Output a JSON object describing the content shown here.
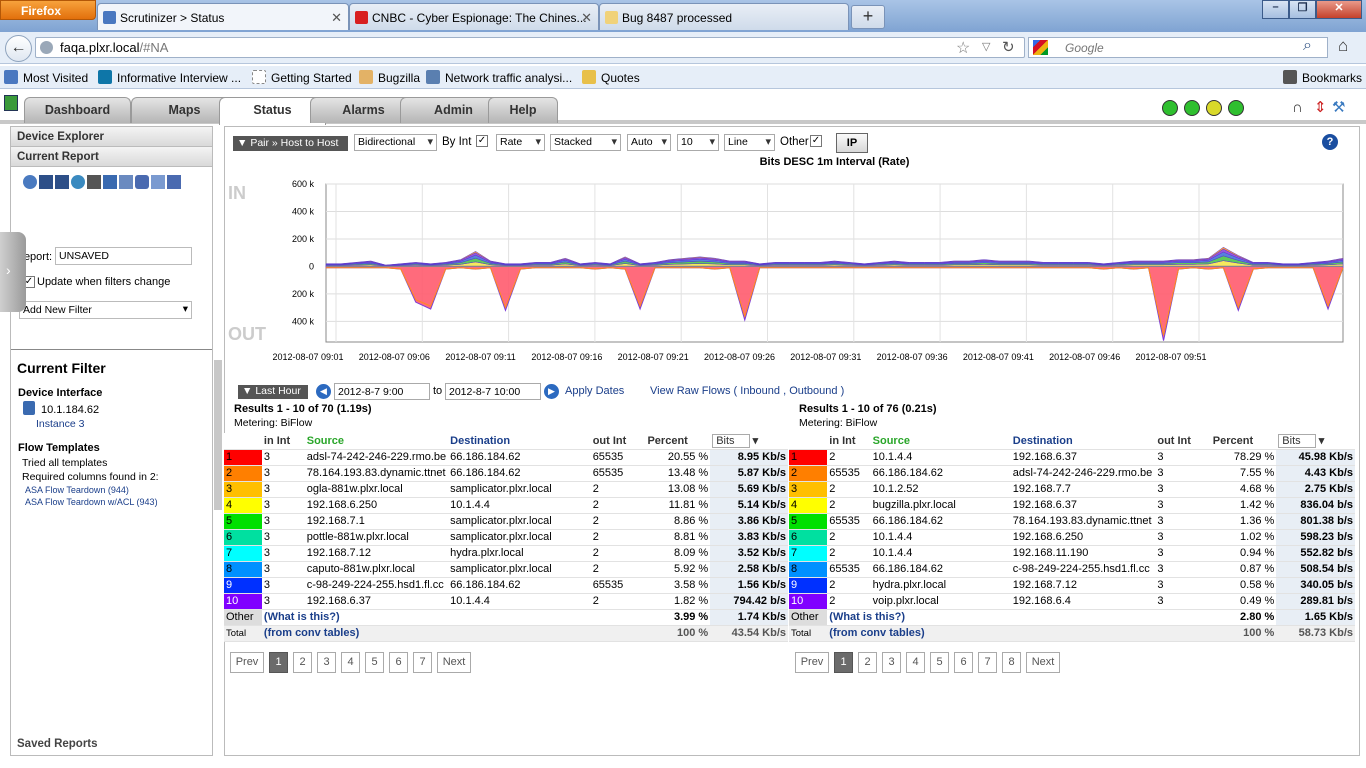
{
  "browser": {
    "menu_label": "Firefox",
    "tabs": [
      {
        "title": "Scrutinizer > Status",
        "active": true,
        "icon_color": "#4a78c0"
      },
      {
        "title": "CNBC - Cyber Espionage: The Chines...",
        "active": false,
        "icon_color": "#d81f1f"
      },
      {
        "title": "Bug 8487 processed",
        "active": false,
        "icon_color": "#f0d27a"
      }
    ],
    "new_tab": "+",
    "url_host": "faqa.plxr.local",
    "url_path": "/#NA",
    "search_placeholder": "Google",
    "bookmarks": [
      {
        "label": "Most Visited",
        "color": "#4a78c0"
      },
      {
        "label": "Informative Interview ...",
        "color": "#0e76a8"
      },
      {
        "label": "Getting Started",
        "color": "#ffffff"
      },
      {
        "label": "Bugzilla",
        "color": "#e3b266"
      },
      {
        "label": "Network traffic analysi...",
        "color": "#5a7fb0"
      },
      {
        "label": "Quotes",
        "color": "#e8c04a"
      }
    ],
    "bookmarks_menu": "Bookmarks"
  },
  "app": {
    "tabs": [
      "Dashboard",
      "Maps",
      "Status",
      "Alarms",
      "Admin",
      "Help"
    ],
    "active_tab": "Status",
    "status_lights": [
      "#2fbf2f",
      "#2fbf2f",
      "#d9d92a",
      "#2fbf2f"
    ]
  },
  "left": {
    "device_explorer": "Device Explorer",
    "current_report": "Current Report",
    "report_label": "Report:",
    "report_value": "UNSAVED",
    "update_label": "Update when filters change",
    "add_filter": "Add New Filter",
    "current_filter": "Current Filter",
    "device_interface": "Device Interface",
    "device_ip": "10.1.184.62",
    "instance": "Instance 3",
    "flow_templates": "Flow Templates",
    "tried_templates": "Tried all templates",
    "required_columns": "Required columns found in 2:",
    "templates": [
      "ASA Flow Teardown (944)",
      "ASA Flow Teardown w/ACL (943)"
    ],
    "saved_reports": "Saved Reports"
  },
  "toolbar": {
    "pair": "Pair » Host to Host",
    "direction": "Bidirectional",
    "by_int": "By Int",
    "rate": "Rate",
    "stacked": "Stacked",
    "auto": "Auto",
    "count": "10",
    "line": "Line",
    "other": "Other",
    "ip_button": "IP"
  },
  "chart_data": {
    "type": "area",
    "title": "Bits DESC 1m Interval (Rate)",
    "in_label": "IN",
    "out_label": "OUT",
    "y_ticks": [
      "600 k",
      "400 k",
      "200 k",
      "0",
      "200 k",
      "400 k"
    ],
    "ylim": [
      -550,
      600
    ],
    "x_ticks": [
      "2012-08-07 09:01",
      "2012-08-07 09:06",
      "2012-08-07 09:11",
      "2012-08-07 09:16",
      "2012-08-07 09:21",
      "2012-08-07 09:26",
      "2012-08-07 09:31",
      "2012-08-07 09:36",
      "2012-08-07 09:41",
      "2012-08-07 09:46",
      "2012-08-07 09:51"
    ],
    "grid": true,
    "in_total": [
      20,
      20,
      30,
      40,
      10,
      20,
      30,
      20,
      30,
      50,
      110,
      40,
      20,
      20,
      30,
      30,
      60,
      20,
      30,
      20,
      70,
      20,
      30,
      50,
      60,
      70,
      60,
      40,
      40,
      20,
      30,
      30,
      30,
      30,
      40,
      30,
      20,
      30,
      40,
      30,
      30,
      30,
      40,
      40,
      50,
      40,
      40,
      40,
      30,
      30,
      30,
      30,
      20,
      30,
      40,
      40,
      40,
      50,
      50,
      60,
      140,
      80,
      30,
      30,
      20,
      20,
      30,
      40,
      60
    ],
    "out_total": [
      -10,
      -10,
      -10,
      -10,
      -10,
      -20,
      -260,
      -310,
      -20,
      -10,
      -20,
      -10,
      -320,
      -20,
      -10,
      -10,
      -10,
      -10,
      -20,
      -10,
      -20,
      -310,
      -10,
      -10,
      -10,
      -10,
      -20,
      -10,
      -390,
      -10,
      -10,
      -10,
      -10,
      -10,
      -10,
      -10,
      -10,
      -10,
      -10,
      -10,
      -10,
      -10,
      -10,
      -10,
      -10,
      -10,
      -10,
      -10,
      -10,
      -10,
      -10,
      -10,
      -20,
      -10,
      -20,
      -10,
      -540,
      -20,
      -10,
      -20,
      -10,
      -320,
      -20,
      -10,
      -10,
      -10,
      -10,
      -310,
      -10
    ],
    "series_colors": [
      "#ff5b6e",
      "#f5e640",
      "#40c040",
      "#3a6bd8",
      "#8a3ad8",
      "#ff8c1a"
    ]
  },
  "time": {
    "range": "Last Hour",
    "from": "2012-8-7 9:00",
    "to_label": "to",
    "to": "2012-8-7 10:00",
    "apply": "Apply Dates",
    "raw_flows": "View Raw Flows ( Inbound , Outbound )"
  },
  "rank_colors": [
    "#ff0000",
    "#ff7f00",
    "#ffbf00",
    "#ffff00",
    "#00e000",
    "#00e0a0",
    "#00ffff",
    "#0090ff",
    "#0030ff",
    "#8000ff"
  ],
  "table_left": {
    "results": "Results 1 - 10 of 70 (1.19s)",
    "metering": "Metering: BiFlow",
    "headers": [
      "in Int",
      "Source",
      "Destination",
      "out Int",
      "Percent",
      "Bits"
    ],
    "rows": [
      [
        "1",
        "3",
        "adsl-74-242-246-229.rmo.be",
        "66.186.184.62",
        "65535",
        "20.55 %",
        "8.95 Kb/s"
      ],
      [
        "2",
        "3",
        "78.164.193.83.dynamic.ttnet",
        "66.186.184.62",
        "65535",
        "13.48 %",
        "5.87 Kb/s"
      ],
      [
        "3",
        "3",
        "ogla-881w.plxr.local",
        "samplicator.plxr.local",
        "2",
        "13.08 %",
        "5.69 Kb/s"
      ],
      [
        "4",
        "3",
        "192.168.6.250",
        "10.1.4.4",
        "2",
        "11.81 %",
        "5.14 Kb/s"
      ],
      [
        "5",
        "3",
        "192.168.7.1",
        "samplicator.plxr.local",
        "2",
        "8.86 %",
        "3.86 Kb/s"
      ],
      [
        "6",
        "3",
        "pottle-881w.plxr.local",
        "samplicator.plxr.local",
        "2",
        "8.81 %",
        "3.83 Kb/s"
      ],
      [
        "7",
        "3",
        "192.168.7.12",
        "hydra.plxr.local",
        "2",
        "8.09 %",
        "3.52 Kb/s"
      ],
      [
        "8",
        "3",
        "caputo-881w.plxr.local",
        "samplicator.plxr.local",
        "2",
        "5.92 %",
        "2.58 Kb/s"
      ],
      [
        "9",
        "3",
        "c-98-249-224-255.hsd1.fl.cc",
        "66.186.184.62",
        "65535",
        "3.58 %",
        "1.56 Kb/s"
      ],
      [
        "10",
        "3",
        "192.168.6.37",
        "10.1.4.4",
        "2",
        "1.82 %",
        "794.42 b/s"
      ]
    ],
    "other": [
      "Other",
      "(What is this?)",
      "3.99 %",
      "1.74 Kb/s"
    ],
    "total": [
      "Total",
      "(from conv tables)",
      "100 %",
      "43.54 Kb/s"
    ],
    "pages": [
      "Prev",
      "1",
      "2",
      "3",
      "4",
      "5",
      "6",
      "7",
      "Next"
    ]
  },
  "table_right": {
    "results": "Results 1 - 10 of 76 (0.21s)",
    "metering": "Metering: BiFlow",
    "headers": [
      "in Int",
      "Source",
      "Destination",
      "out Int",
      "Percent",
      "Bits"
    ],
    "rows": [
      [
        "1",
        "2",
        "10.1.4.4",
        "192.168.6.37",
        "3",
        "78.29 %",
        "45.98 Kb/s"
      ],
      [
        "2",
        "65535",
        "66.186.184.62",
        "adsl-74-242-246-229.rmo.be",
        "3",
        "7.55 %",
        "4.43 Kb/s"
      ],
      [
        "3",
        "2",
        "10.1.2.52",
        "192.168.7.7",
        "3",
        "4.68 %",
        "2.75 Kb/s"
      ],
      [
        "4",
        "2",
        "bugzilla.plxr.local",
        "192.168.6.37",
        "3",
        "1.42 %",
        "836.04 b/s"
      ],
      [
        "5",
        "65535",
        "66.186.184.62",
        "78.164.193.83.dynamic.ttnet",
        "3",
        "1.36 %",
        "801.38 b/s"
      ],
      [
        "6",
        "2",
        "10.1.4.4",
        "192.168.6.250",
        "3",
        "1.02 %",
        "598.23 b/s"
      ],
      [
        "7",
        "2",
        "10.1.4.4",
        "192.168.11.190",
        "3",
        "0.94 %",
        "552.82 b/s"
      ],
      [
        "8",
        "65535",
        "66.186.184.62",
        "c-98-249-224-255.hsd1.fl.cc",
        "3",
        "0.87 %",
        "508.54 b/s"
      ],
      [
        "9",
        "2",
        "hydra.plxr.local",
        "192.168.7.12",
        "3",
        "0.58 %",
        "340.05 b/s"
      ],
      [
        "10",
        "2",
        "voip.plxr.local",
        "192.168.6.4",
        "3",
        "0.49 %",
        "289.81 b/s"
      ]
    ],
    "other": [
      "Other",
      "(What is this?)",
      "2.80 %",
      "1.65 Kb/s"
    ],
    "total": [
      "Total",
      "(from conv tables)",
      "100 %",
      "58.73 Kb/s"
    ],
    "pages": [
      "Prev",
      "1",
      "2",
      "3",
      "4",
      "5",
      "6",
      "7",
      "8",
      "Next"
    ]
  }
}
